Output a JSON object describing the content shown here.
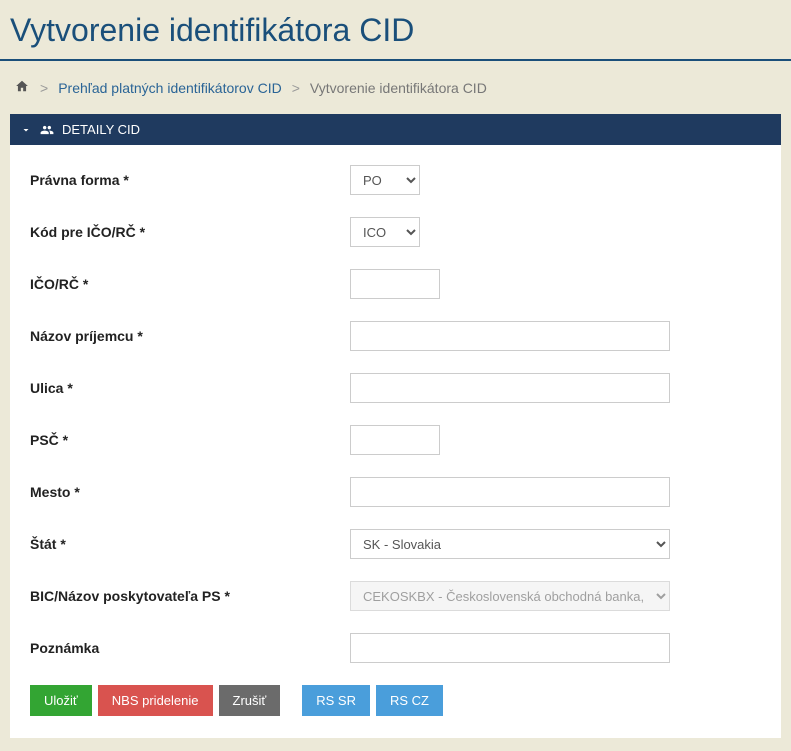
{
  "title": "Vytvorenie identifikátora CID",
  "breadcrumbs": {
    "link": "Prehľad platných identifikátorov CID",
    "current": "Vytvorenie identifikátora CID"
  },
  "panel": {
    "header": "DETAILY CID"
  },
  "form": {
    "pravna_forma": {
      "label": "Právna forma *",
      "value": "PO"
    },
    "kod_ico": {
      "label": "Kód pre IČO/RČ *",
      "value": "ICO"
    },
    "ico_rc": {
      "label": "IČO/RČ *",
      "value": ""
    },
    "nazov_prijemcu": {
      "label": "Názov príjemcu *",
      "value": ""
    },
    "ulica": {
      "label": "Ulica *",
      "value": ""
    },
    "psc": {
      "label": "PSČ *",
      "value": ""
    },
    "mesto": {
      "label": "Mesto *",
      "value": ""
    },
    "stat": {
      "label": "Štát *",
      "value": "SK - Slovakia"
    },
    "bic": {
      "label": "BIC/Názov poskytovateľa PS *",
      "value": "CEKOSKBX - Československá obchodná banka, a.s."
    },
    "poznamka": {
      "label": "Poznámka",
      "value": ""
    }
  },
  "buttons": {
    "save": "Uložiť",
    "nbs": "NBS pridelenie",
    "cancel": "Zrušiť",
    "rs_sr": "RS SR",
    "rs_cz": "RS CZ"
  }
}
